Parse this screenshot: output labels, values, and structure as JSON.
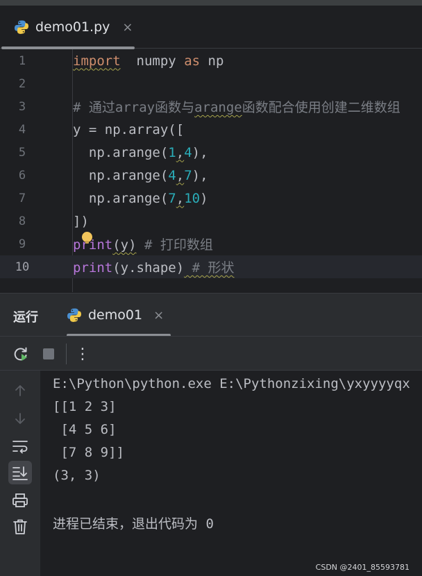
{
  "editor_tab": {
    "filename": "demo01.py",
    "close": "×"
  },
  "code_lines": [
    {
      "num": "1"
    },
    {
      "num": "2"
    },
    {
      "num": "3"
    },
    {
      "num": "4"
    },
    {
      "num": "5"
    },
    {
      "num": "6"
    },
    {
      "num": "7"
    },
    {
      "num": "8"
    },
    {
      "num": "9"
    },
    {
      "num": "10"
    }
  ],
  "code": {
    "l1_import": "import",
    "l1_mod": "numpy",
    "l1_as": "as",
    "l1_alias": "np",
    "l3_comment_a": "# 通过",
    "l3_comment_b": "array",
    "l3_comment_c": "函数与",
    "l3_comment_d": "arange",
    "l3_comment_e": "函数配合使用创建二维数组",
    "l4": "y = np.array([",
    "l5_pre": "  np.arange(",
    "l5_a": "1",
    "l5_comma": ",",
    "l5_b": "4",
    "l5_post": "),",
    "l6_pre": "  np.arange(",
    "l6_a": "4",
    "l6_comma": ",",
    "l6_b": "7",
    "l6_post": "),",
    "l7_pre": "  np.arange(",
    "l7_a": "7",
    "l7_comma": ",",
    "l7_b": "10",
    "l7_post": ")",
    "l8": "])",
    "l9_fn": "print",
    "l9_args": "(y)",
    "l9_comment": " # 打印数组",
    "l10_fn": "print",
    "l10_args": "(y.shape)",
    "l10_comment": " # 形状"
  },
  "run_panel": {
    "title": "运行",
    "tab_name": "demo01",
    "close": "×",
    "more": "⋮"
  },
  "console_lines": [
    "E:\\Python\\python.exe E:\\Pythonzixing\\yxyyyyqx",
    "[[1 2 3]",
    " [4 5 6]",
    " [7 8 9]]",
    "(3, 3)",
    "",
    "进程已结束，退出代码为 0"
  ],
  "watermark": "CSDN @2401_85593781",
  "colors": {
    "background": "#1e1f22",
    "panel": "#2b2d30",
    "keyword": "#cf8e6d",
    "function": "#b877db",
    "number": "#2aacb8",
    "comment": "#7a7e85"
  },
  "icons": {
    "editor_tab": "python-icon",
    "run_tab": "python-icon",
    "rerun": "rerun-icon",
    "stop": "stop-icon",
    "scroll_up": "arrow-up-icon",
    "scroll_down": "arrow-down-icon",
    "soft_wrap": "soft-wrap-icon",
    "scroll_to_end": "scroll-to-end-icon",
    "print": "print-icon",
    "clear": "trash-icon",
    "intention": "lightbulb-icon"
  }
}
